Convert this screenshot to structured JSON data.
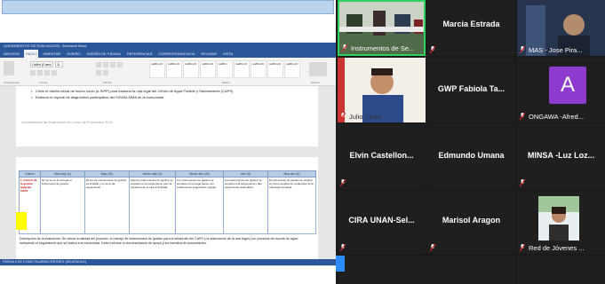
{
  "word": {
    "title": "LINEAMIENTOS DE EVALUACION - Microsoft Word",
    "tabs": [
      "ARCHIVO",
      "INICIO",
      "INSERTAR",
      "DISEÑO",
      "DISEÑO DE PÁGINA",
      "REFERENCIAS",
      "CORRESPONDENCIA",
      "REVISAR",
      "VISTA"
    ],
    "font_name": "Calibri (Cuerp",
    "font_size": "11",
    "styles": [
      "AaBbCcD",
      "AaBbCcD",
      "AaBbCcD",
      "AaBbCcD",
      "AaBbC",
      "AaBbCcD",
      "AaBbCcD",
      "AaBbCcD",
      "AaBbCcD"
    ],
    "groups": [
      "Portapapeles",
      "Fuente",
      "Párrafo",
      "Estilos",
      "Edición"
    ],
    "bullets": [
      "Crear el diseño inicial de nuevo curso (e-SIPP) para elaborar la ruta legal del Centro de Agua Potable y Saneamiento (CAPS)",
      "Elaborar el reporte de diagnóstico participativo del SIGAM-SIMA en la comunidad"
    ],
    "footer": "Lineamientos de Evaluación del curso de Formación 2021",
    "rubric_headers": [
      "Criterio",
      "Muy bajo (1)",
      "Bajo (20)",
      "Medio bajo (3)",
      "Medio alto (40)",
      "Alto (5)",
      "Muy alto (6)"
    ],
    "rubric_row": [
      "1. Control de la gestión legal del CAPS",
      "No se ve en la entrega el instrumento de gestión",
      "El uso de instrumentos de gestión es limitado y no se le da seguimiento",
      "Algunos instrumentos de gestión se emplean en la carga plena, pero la cobertura de la ruta es limitada",
      "Los instrumentos de gestión se emplean en la carga plena, con evidencia de seguimiento regular",
      "Los instrumentos de gestión se emplean a la carga plena y dan seguimiento sistemático",
      "El instrumento de gestión se emplea en forma amplia con evidencias de la ruta legal completa"
    ],
    "description": "Descripción de la evaluación: Se valora la calidad del proyecto, el manejo de instrumentos de gestión para el desarrollo del CAPS y la elaboración de la ruta legal y los procesos de reporte de agua, incluyendo el seguimiento que se realiza a la comunidad. Debe incluirse la documentación de apoyo y los formatos de presentación.",
    "status": "PÁGINA 6 DE 9   1845 PALABRAS   ESPAÑOL (NICARAGUA)"
  },
  "participants": [
    {
      "kind": "video",
      "label": "Instrumentos de Se...",
      "speaking": true
    },
    {
      "kind": "name",
      "name": "Marcia Estrada",
      "label": ""
    },
    {
      "kind": "video",
      "label": "MAS - Jose Pira..."
    },
    {
      "kind": "video",
      "label": "Julio Chow"
    },
    {
      "kind": "name",
      "name": "GWP Fabiola Ta...",
      "label": ""
    },
    {
      "kind": "avatar",
      "initial": "A",
      "label": "ONGAWA -Afred..."
    },
    {
      "kind": "name",
      "name": "Elvin  Castellon...",
      "label": ""
    },
    {
      "kind": "name",
      "name": "Edmundo Umana",
      "label": ""
    },
    {
      "kind": "name",
      "name": "MINSA  -Luz Loz...",
      "label": ""
    },
    {
      "kind": "name",
      "name": "CIRA  UNAN-Sel...",
      "label": ""
    },
    {
      "kind": "name",
      "name": "Marisol Aragon",
      "label": ""
    },
    {
      "kind": "video",
      "label": "Red de Jóvenes ..."
    }
  ],
  "colors": {
    "word_blue": "#2b579a",
    "speaking_border": "#2dd35c",
    "avatar_purple": "#8e3acf",
    "mic_muted": "#e02828",
    "gallery_bg": "#1a1a1a"
  }
}
